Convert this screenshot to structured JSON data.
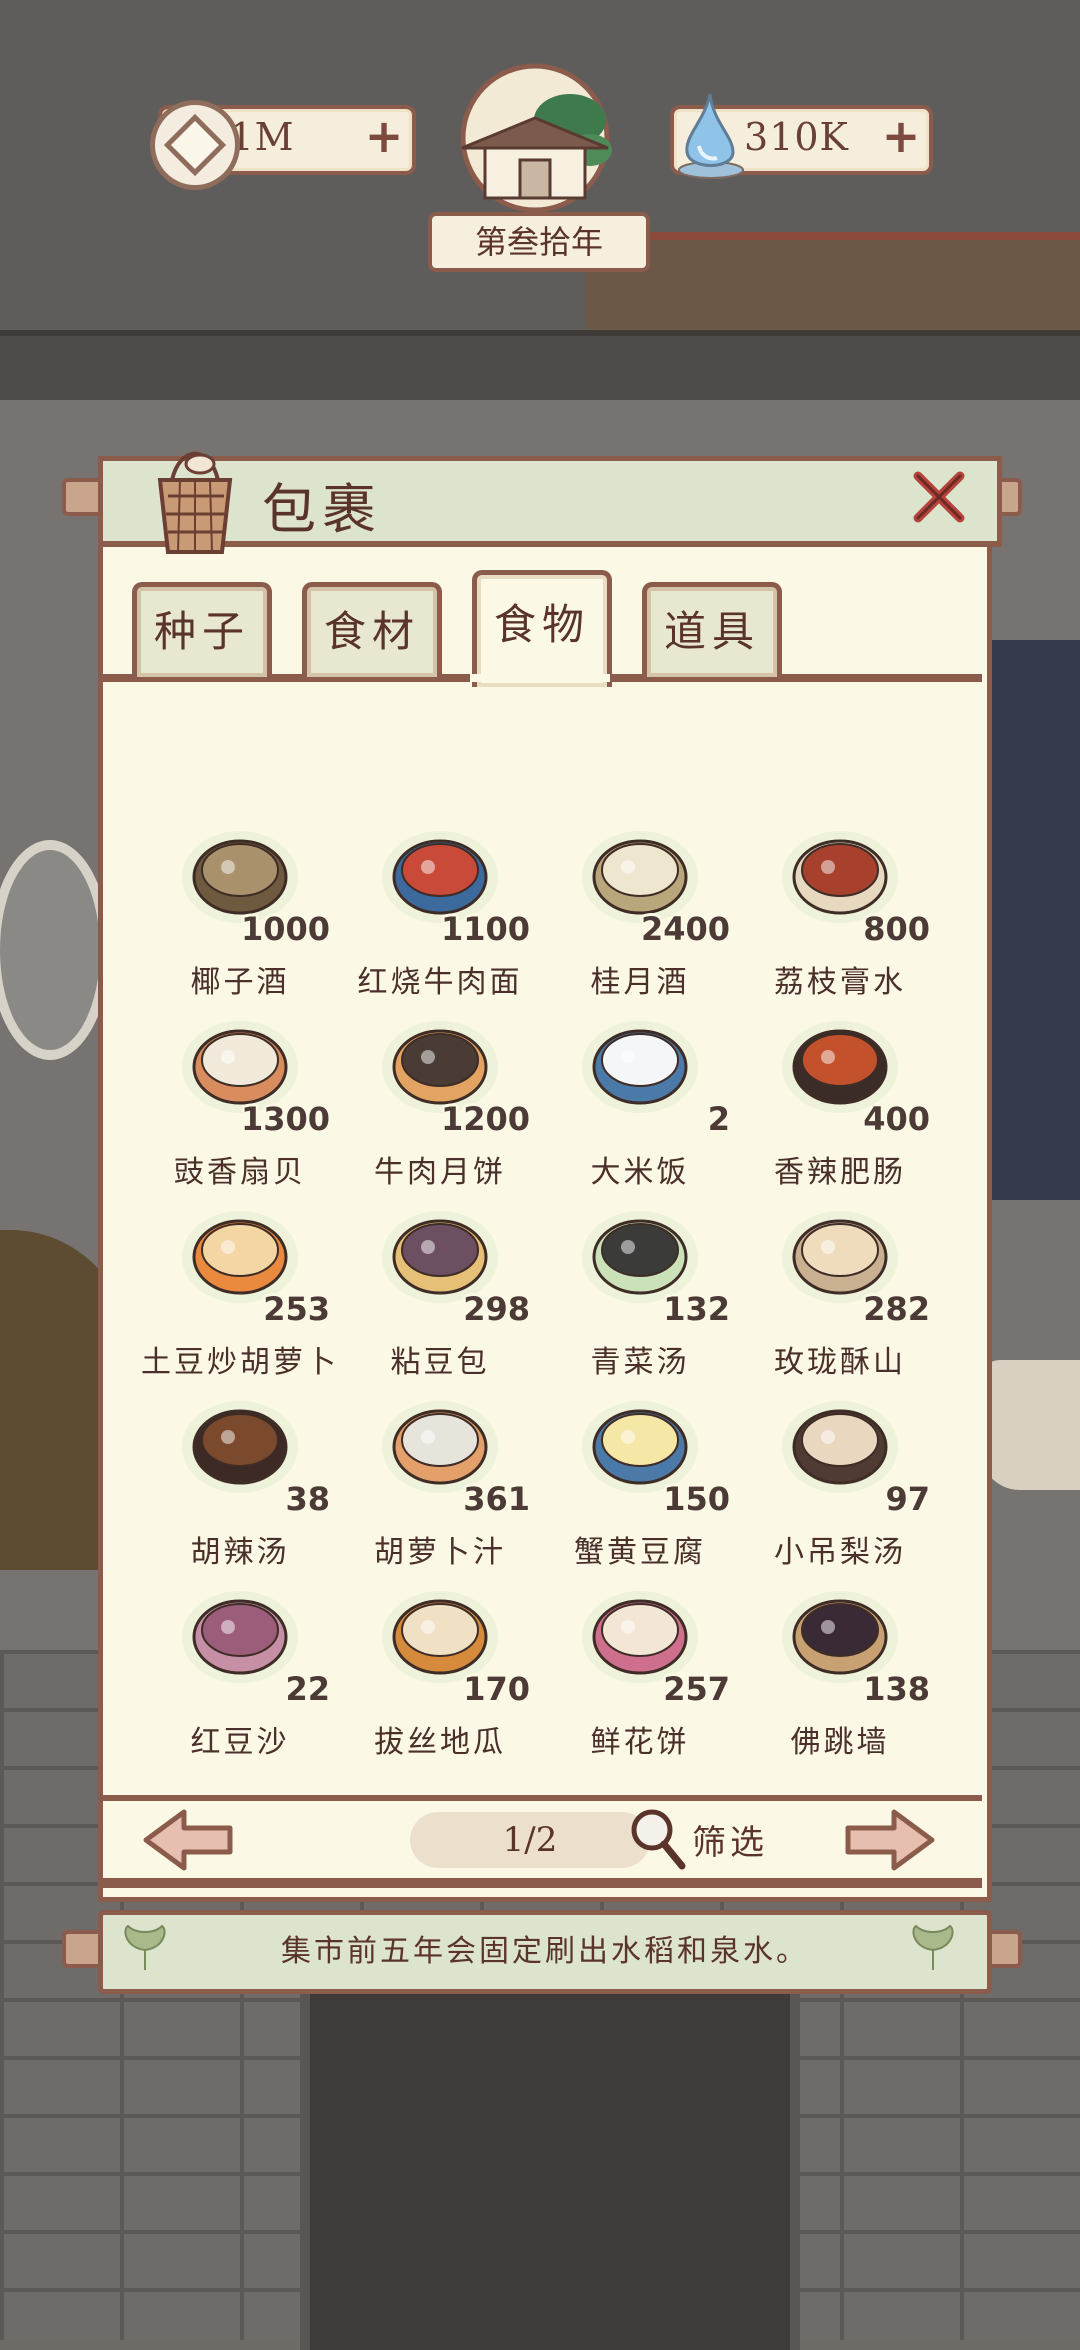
{
  "hud": {
    "coins": "1M",
    "water": "310K",
    "plus": "+",
    "year": "第叁拾年"
  },
  "bag": {
    "title": "包裹",
    "tabs": [
      {
        "label": "种子",
        "active": false
      },
      {
        "label": "食材",
        "active": false
      },
      {
        "label": "食物",
        "active": true
      },
      {
        "label": "道具",
        "active": false
      }
    ],
    "items": [
      {
        "name": "椰子酒",
        "count": "1000",
        "icon": "coconut-wine-icon"
      },
      {
        "name": "红烧牛肉面",
        "count": "1100",
        "icon": "beef-noodle-icon"
      },
      {
        "name": "桂月酒",
        "count": "2400",
        "icon": "osmanthus-wine-icon"
      },
      {
        "name": "荔枝膏水",
        "count": "800",
        "icon": "lychee-drink-icon"
      },
      {
        "name": "豉香扇贝",
        "count": "1300",
        "icon": "scallop-icon"
      },
      {
        "name": "牛肉月饼",
        "count": "1200",
        "icon": "mooncake-icon"
      },
      {
        "name": "大米饭",
        "count": "2",
        "icon": "rice-bowl-icon"
      },
      {
        "name": "香辣肥肠",
        "count": "400",
        "icon": "spicy-intestine-icon"
      },
      {
        "name": "土豆炒胡萝卜",
        "count": "253",
        "icon": "potato-carrot-icon"
      },
      {
        "name": "粘豆包",
        "count": "298",
        "icon": "bean-bun-icon"
      },
      {
        "name": "青菜汤",
        "count": "132",
        "icon": "greens-soup-icon"
      },
      {
        "name": "玫珑酥山",
        "count": "282",
        "icon": "crisp-mountain-icon"
      },
      {
        "name": "胡辣汤",
        "count": "38",
        "icon": "pepper-soup-icon"
      },
      {
        "name": "胡萝卜汁",
        "count": "361",
        "icon": "carrot-juice-icon"
      },
      {
        "name": "蟹黄豆腐",
        "count": "150",
        "icon": "crab-tofu-icon"
      },
      {
        "name": "小吊梨汤",
        "count": "97",
        "icon": "pear-soup-icon"
      },
      {
        "name": "红豆沙",
        "count": "22",
        "icon": "red-bean-icon"
      },
      {
        "name": "拔丝地瓜",
        "count": "170",
        "icon": "candied-potato-icon"
      },
      {
        "name": "鲜花饼",
        "count": "257",
        "icon": "flower-cake-icon"
      },
      {
        "name": "佛跳墙",
        "count": "138",
        "icon": "buddha-jumps-icon"
      }
    ],
    "page": "1/2",
    "filter_label": "筛选"
  },
  "tip": "集市前五年会固定刷出水稻和泉水。",
  "colors": {
    "border": "#8b5b4c",
    "panel": "#fbf9e6",
    "header": "#dde4cd",
    "text": "#5a332b"
  }
}
